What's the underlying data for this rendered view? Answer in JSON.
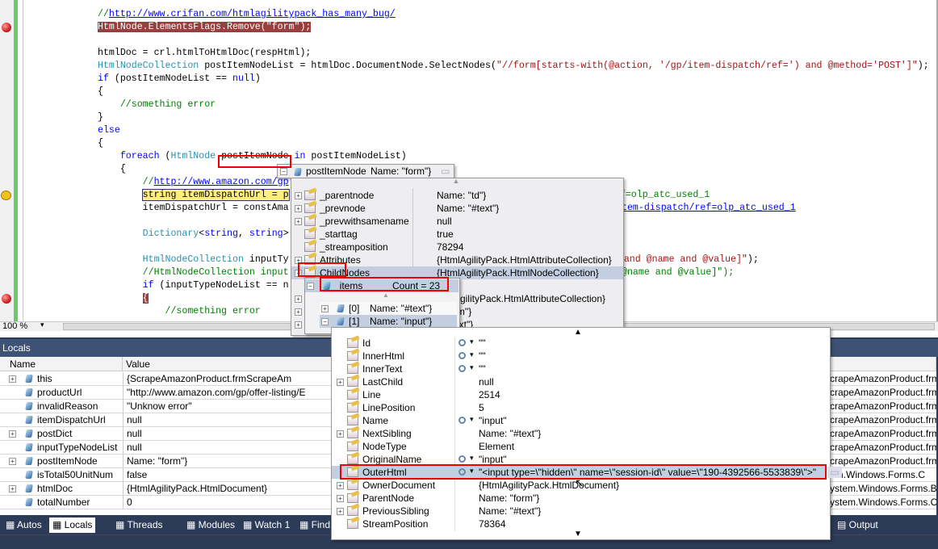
{
  "editor": {
    "lines": [
      [
        {
          "t": "//",
          "c": "cm"
        },
        {
          "t": "http://www.crifan.com/htmlagilitypack_has_many_bug/",
          "c": "ln"
        }
      ],
      [
        {
          "t": "HtmlNode.ElementsFlags.Remove(\"form\");",
          "c": "bp"
        }
      ],
      [],
      [
        {
          "t": "htmlDoc = crl.htmlToHtmlDoc(respHtml);",
          "c": "tx"
        }
      ],
      [
        {
          "t": "HtmlNodeCollection",
          "c": "ty"
        },
        {
          "t": " postItemNodeList = htmlDoc.DocumentNode.SelectNodes(",
          "c": "tx"
        },
        {
          "t": "\"//form[starts-with(@action, '/gp/item-dispatch/ref=') and @method='POST']\"",
          "c": "str"
        },
        {
          "t": ");",
          "c": "tx"
        }
      ],
      [
        {
          "t": "if",
          "c": "kw"
        },
        {
          "t": " (postItemNodeList == ",
          "c": "tx"
        },
        {
          "t": "null",
          "c": "kw"
        },
        {
          "t": ")",
          "c": "tx"
        }
      ],
      [
        {
          "t": "{",
          "c": "tx"
        }
      ],
      [
        {
          "t": "    //something error",
          "c": "cm"
        }
      ],
      [
        {
          "t": "}",
          "c": "tx"
        }
      ],
      [
        {
          "t": "else",
          "c": "kw"
        }
      ],
      [
        {
          "t": "{",
          "c": "tx"
        }
      ],
      [
        {
          "t": "    ",
          "c": "tx"
        },
        {
          "t": "foreach",
          "c": "kw"
        },
        {
          "t": " (",
          "c": "tx"
        },
        {
          "t": "HtmlNode",
          "c": "ty"
        },
        {
          "t": " postItemNode ",
          "c": "tx"
        },
        {
          "t": "in",
          "c": "kw"
        },
        {
          "t": " postItemNodeList)",
          "c": "tx"
        }
      ],
      [
        {
          "t": "    {",
          "c": "tx"
        }
      ],
      [
        {
          "t": "        //",
          "c": "cm"
        },
        {
          "t": "http://www.amazon.com/gp",
          "c": "ln"
        }
      ],
      [
        {
          "t": "        ",
          "c": "tx"
        },
        {
          "t": "string itemDispatchUrl = p",
          "c": "cur"
        }
      ],
      [
        {
          "t": "        itemDispatchUrl = constAma",
          "c": "tx"
        }
      ],
      [],
      [
        {
          "t": "        ",
          "c": "tx"
        },
        {
          "t": "Dictionary",
          "c": "ty"
        },
        {
          "t": "<",
          "c": "tx"
        },
        {
          "t": "string",
          "c": "kw"
        },
        {
          "t": ", ",
          "c": "tx"
        },
        {
          "t": "string",
          "c": "kw"
        },
        {
          "t": ">",
          "c": "tx"
        }
      ],
      [],
      [
        {
          "t": "        ",
          "c": "tx"
        },
        {
          "t": "HtmlNodeCollection",
          "c": "ty"
        },
        {
          "t": " inputTy",
          "c": "tx"
        }
      ],
      [
        {
          "t": "        //HtmlNodeCollection input",
          "c": "cm"
        }
      ],
      [
        {
          "t": "        ",
          "c": "tx"
        },
        {
          "t": "if",
          "c": "kw"
        },
        {
          "t": " (inputTypeNodeList == n",
          "c": "tx"
        }
      ],
      [
        {
          "t": "        ",
          "c": "tx"
        },
        {
          "t": "{",
          "c": "bp"
        }
      ],
      [
        {
          "t": "            //something error",
          "c": "cm"
        }
      ]
    ],
    "tails": [
      {
        "line": 14,
        "segs": [
          {
            "t": "/ref=olp_atc_used_1",
            "c": "cm"
          }
        ]
      },
      {
        "line": 15,
        "segs": [
          {
            "t": "tem-dispatch/ref=olp_atc_used_1",
            "c": "ln"
          }
        ]
      },
      {
        "line": 19,
        "segs": [
          {
            "t": "en'",
            "c": "str"
          },
          {
            "t": " and @name and @value]\"",
            "c": "str"
          },
          {
            "t": ");",
            "c": "tx"
          }
        ]
      },
      {
        "line": 20,
        "segs": [
          {
            "t": "@name and @value]\");",
            "c": "cm"
          }
        ]
      }
    ],
    "breakpoint_lines": [
      1,
      22
    ],
    "current_line": 14,
    "zoom": "100 %"
  },
  "tooltip": {
    "name": "postItemNode",
    "value": "Name: \"form\"}"
  },
  "node_popup": {
    "rows": [
      {
        "name": "_parentnode",
        "value": "Name: \"td\"}",
        "expand": true
      },
      {
        "name": "_prevnode",
        "value": "Name: \"#text\"}",
        "expand": true
      },
      {
        "name": "_prevwithsamename",
        "value": "null",
        "expand": true
      },
      {
        "name": "_starttag",
        "value": "true",
        "expand": false
      },
      {
        "name": "_streamposition",
        "value": "78294",
        "expand": false
      },
      {
        "name": "Attributes",
        "value": "{HtmlAgilityPack.HtmlAttributeCollection}",
        "expand": true
      },
      {
        "name": "ChildNodes",
        "value": "{HtmlAgilityPack.HtmlNodeCollection}",
        "expand": true,
        "selected": true
      },
      {
        "name": "",
        "value": "",
        "expand": false
      },
      {
        "name": "",
        "value": "m\"}  AgilityPack.HtmlAttributeCollection}",
        "expand": true
      },
      {
        "name": "",
        "value": ": \"form\"}",
        "expand": true
      },
      {
        "name": "",
        "value": ": \"#text\"}",
        "expand": true
      }
    ]
  },
  "items_popup": {
    "name": "_items",
    "count": "Count = 23",
    "rows": [
      {
        "index": "[0]",
        "value": "Name: \"#text\"}"
      },
      {
        "index": "[1]",
        "value": "Name: \"input\"}"
      }
    ]
  },
  "input_popup": {
    "rows": [
      {
        "name": "Id",
        "value": "\"\"",
        "viz": true,
        "expand": false
      },
      {
        "name": "InnerHtml",
        "value": "\"\"",
        "viz": true,
        "expand": false
      },
      {
        "name": "InnerText",
        "value": "\"\"",
        "viz": true,
        "expand": false
      },
      {
        "name": "LastChild",
        "value": "null",
        "viz": false,
        "expand": true
      },
      {
        "name": "Line",
        "value": "2514",
        "viz": false,
        "expand": false
      },
      {
        "name": "LinePosition",
        "value": "5",
        "viz": false,
        "expand": false
      },
      {
        "name": "Name",
        "value": "\"input\"",
        "viz": true,
        "expand": false
      },
      {
        "name": "NextSibling",
        "value": "Name: \"#text\"}",
        "viz": false,
        "expand": true
      },
      {
        "name": "NodeType",
        "value": "Element",
        "viz": false,
        "expand": false
      },
      {
        "name": "OriginalName",
        "value": "\"input\"",
        "viz": true,
        "expand": false
      },
      {
        "name": "OuterHtml",
        "value": "\"<input type=\\\"hidden\\\" name=\\\"session-id\\\" value=\\\"190-4392566-5533839\\\">\"",
        "viz": true,
        "expand": false,
        "selected": true
      },
      {
        "name": "OwnerDocument",
        "value": "{HtmlAgilityPack.HtmlDocument}",
        "viz": false,
        "expand": true
      },
      {
        "name": "ParentNode",
        "value": "Name: \"form\"}",
        "viz": false,
        "expand": true
      },
      {
        "name": "PreviousSibling",
        "value": "Name: \"#text\"}",
        "viz": false,
        "expand": true
      },
      {
        "name": "StreamPosition",
        "value": "78364",
        "viz": false,
        "expand": false
      }
    ]
  },
  "locals": {
    "title": "Locals",
    "columns": [
      "Name",
      "Value"
    ],
    "rows": [
      {
        "name": "this",
        "value": "{ScrapeAmazonProduct.frmScrapeAm",
        "type": "crapeAmazonProduct.frm",
        "expand": true
      },
      {
        "name": "productUrl",
        "value": "\"http://www.amazon.com/gp/offer-listing/E",
        "type": "crapeAmazonProduct.frm",
        "expand": false
      },
      {
        "name": "invalidReason",
        "value": "\"Unknow error\"",
        "type": "crapeAmazonProduct.frm",
        "expand": false
      },
      {
        "name": "itemDispatchUrl",
        "value": "null",
        "type": "crapeAmazonProduct.frm",
        "expand": false
      },
      {
        "name": "postDict",
        "value": "null",
        "type": "crapeAmazonProduct.frm",
        "expand": true
      },
      {
        "name": "inputTypeNodeList",
        "value": "null",
        "type": "crapeAmazonProduct.frm",
        "expand": false
      },
      {
        "name": "postItemNode",
        "value": "Name: \"form\"}",
        "type": "crapeAmazonProduct.frm",
        "expand": true
      },
      {
        "name": "isTotal50UnitNum",
        "value": "false",
        "type": "em.Windows.Forms.C",
        "expand": false
      },
      {
        "name": "htmlDoc",
        "value": "{HtmlAgilityPack.HtmlDocument}",
        "type": "ystem.Windows.Forms.B",
        "expand": true
      },
      {
        "name": "totalNumber",
        "value": "0",
        "type": "ystem.Windows.Forms.C",
        "expand": false
      }
    ]
  },
  "tabs": [
    {
      "label": "Autos",
      "active": false
    },
    {
      "label": "Locals",
      "active": true
    },
    {
      "label": "Threads",
      "active": false
    },
    {
      "label": "Modules",
      "active": false
    },
    {
      "label": "Watch 1",
      "active": false
    },
    {
      "label": "Find Sy",
      "active": false
    }
  ],
  "output_tab": "Output",
  "colors": {
    "panel": "#2b3b58",
    "breakpoint": "#c22",
    "highlight_box": "#e00",
    "selection": "#c3cfe0"
  }
}
